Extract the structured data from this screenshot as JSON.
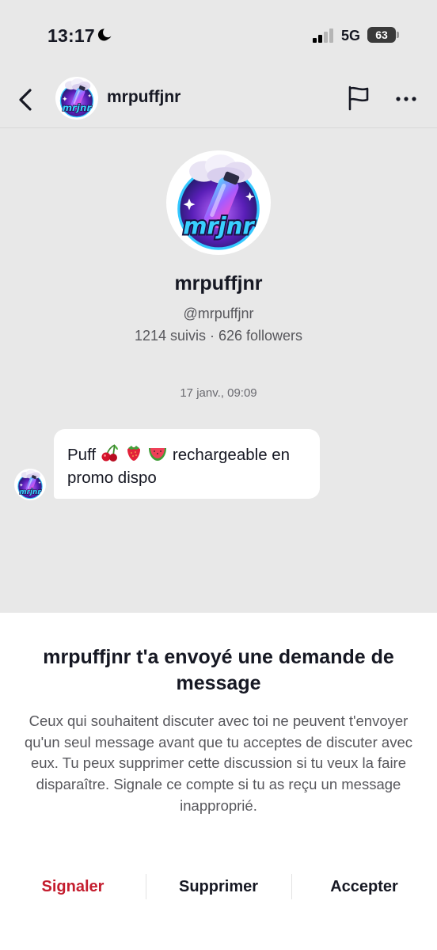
{
  "status_bar": {
    "time": "13:17",
    "network": "5G",
    "battery": "63"
  },
  "header": {
    "username": "mrpuffjnr"
  },
  "profile": {
    "name": "mrpuffjnr",
    "handle": "@mrpuffjnr",
    "stats": "1214 suivis · 626 followers",
    "logo_text": "mrjnr"
  },
  "conversation": {
    "timestamp": "17 janv., 09:09",
    "message": {
      "prefix": "Puff",
      "emojis": [
        "cherries-emoji",
        "strawberry-emoji",
        "watermelon-emoji"
      ],
      "suffix": "rechargeable en",
      "line2": "promo dispo"
    }
  },
  "sheet": {
    "title": "mrpuffjnr t'a envoyé une demande de message",
    "body": "Ceux qui souhaitent discuter avec toi ne peuvent t'envoyer qu'un seul message avant que tu acceptes de discuter avec eux. Tu peux supprimer cette discussion si tu veux la faire disparaître. Signale ce compte si tu as reçu un message inapproprié.",
    "actions": {
      "report": "Signaler",
      "delete": "Supprimer",
      "accept": "Accepter"
    }
  },
  "colors": {
    "background": "#e8e8e8",
    "report": "#c41d2e",
    "text": "#161823",
    "secondary": "#57575c"
  }
}
